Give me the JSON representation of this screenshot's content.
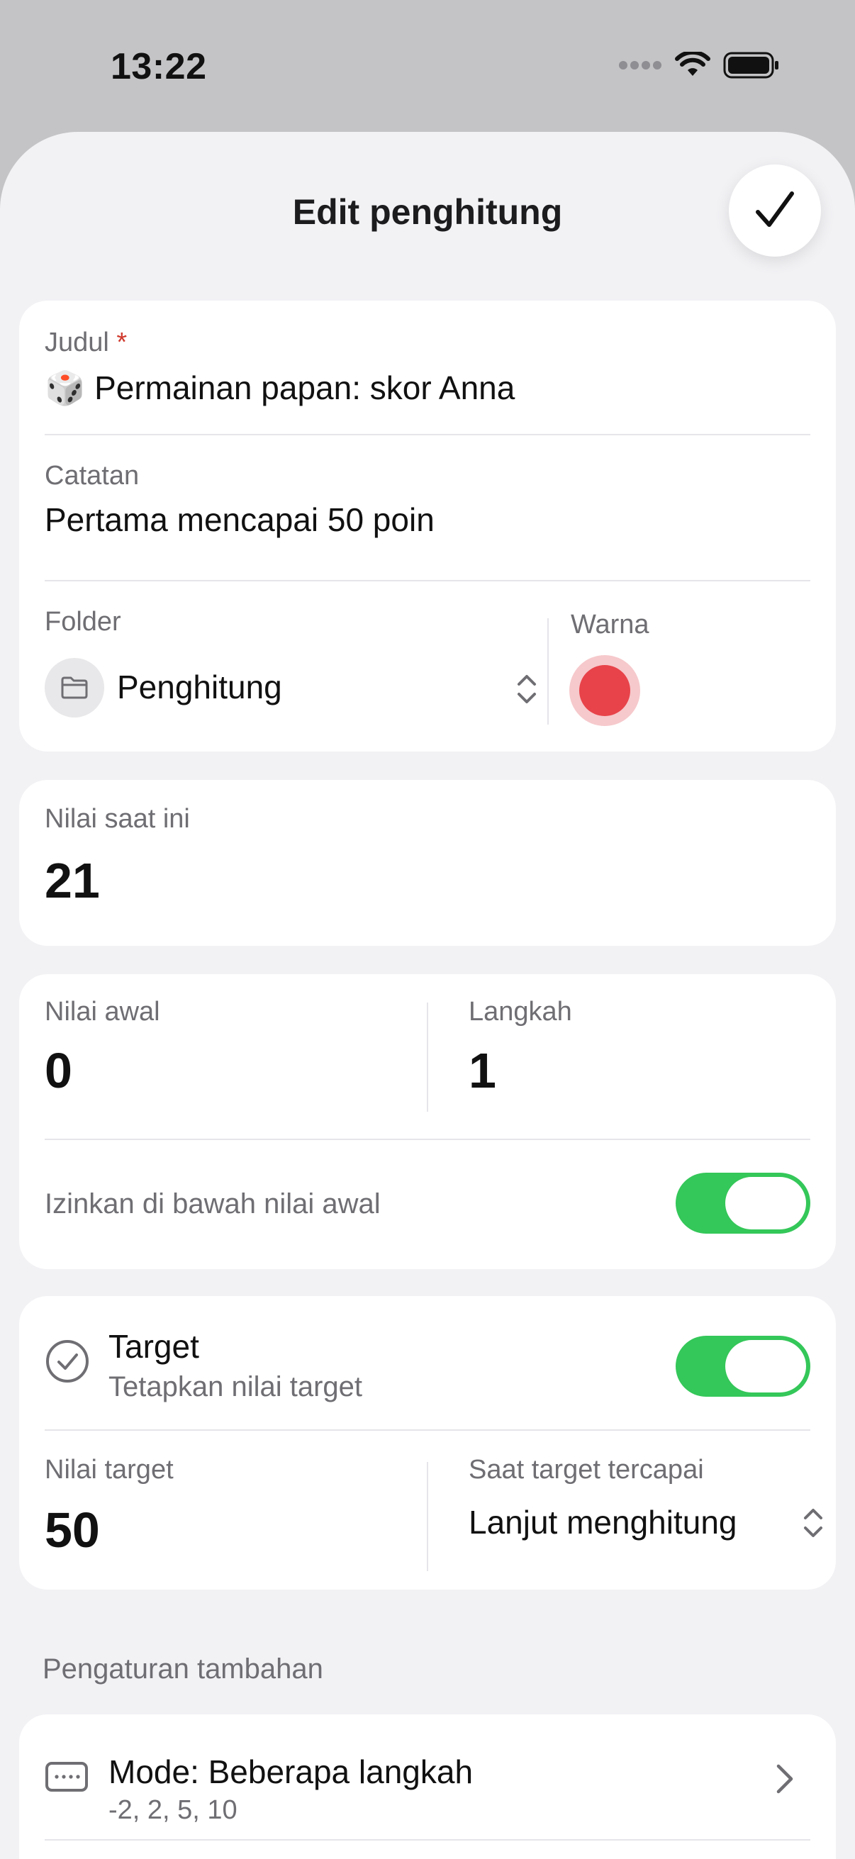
{
  "status": {
    "time": "13:22"
  },
  "header": {
    "title": "Edit penghitung",
    "done_icon": "checkmark-icon"
  },
  "basic": {
    "title_label": "Judul",
    "required_mark": "*",
    "title_emoji": "🎲",
    "title_value": "Permainan papan: skor Anna",
    "notes_label": "Catatan",
    "notes_value": "Pertama mencapai 50 poin",
    "folder_label": "Folder",
    "folder_value": "Penghitung",
    "color_label": "Warna",
    "color_value": "#e8434a"
  },
  "current": {
    "label": "Nilai saat ini",
    "value": "21"
  },
  "values": {
    "start_label": "Nilai awal",
    "start_value": "0",
    "step_label": "Langkah",
    "step_value": "1",
    "allow_below_label": "Izinkan di bawah nilai awal",
    "allow_below_on": true
  },
  "target": {
    "title": "Target",
    "subtitle": "Tetapkan nilai target",
    "enabled": true,
    "value_label": "Nilai target",
    "value": "50",
    "on_reach_label": "Saat target tercapai",
    "on_reach_value": "Lanjut menghitung"
  },
  "extra": {
    "caption": "Pengaturan tambahan",
    "mode_title": "Mode: Beberapa langkah",
    "mode_steps": "-2, 2, 5, 10"
  },
  "colors": {
    "accent_green": "#34c759",
    "required_red": "#d03a2e"
  }
}
